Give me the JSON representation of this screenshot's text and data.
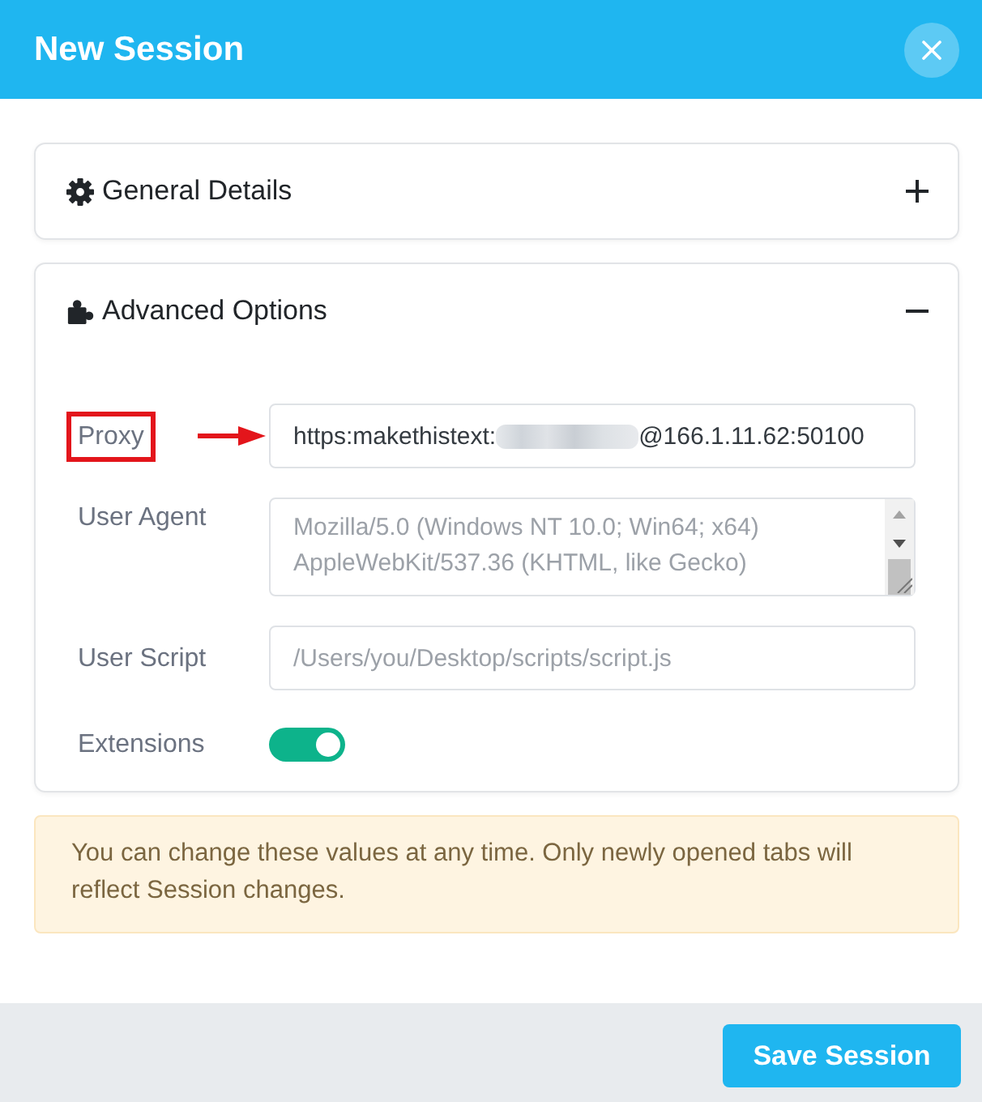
{
  "header": {
    "title": "New Session"
  },
  "sections": [
    {
      "title": "General Details",
      "expanded": false
    },
    {
      "title": "Advanced Options",
      "expanded": true,
      "fields": [
        {
          "kind": "text",
          "label": "Proxy",
          "highlighted": true,
          "value": [
            "https:makethistext:",
            "@166.1.11.62:50100"
          ],
          "redacted": true
        },
        {
          "kind": "textarea",
          "label": "User Agent",
          "placeholder": "Mozilla/5.0 (Windows NT 10.0; Win64; x64) AppleWebKit/537.36 (KHTML, like Gecko)"
        },
        {
          "kind": "text",
          "label": "User Script",
          "placeholder": "/Users/you/Desktop/scripts/script.js"
        },
        {
          "kind": "toggle",
          "label": "Extensions",
          "on": true
        }
      ]
    }
  ],
  "notice": {
    "text": "You can change these values at any time. Only newly opened tabs will reflect Session changes."
  },
  "footer": {
    "save_button": "Save Session"
  }
}
